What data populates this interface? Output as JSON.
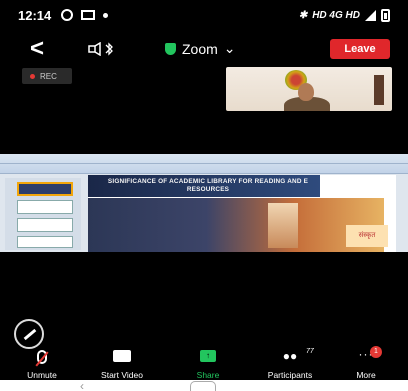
{
  "status_bar": {
    "time": "12:14",
    "network": "HD 4G HD",
    "battery_icon": "battery-icon"
  },
  "header": {
    "back_icon": "back-chevron-icon",
    "speaker_icon": "bluetooth-speaker-icon",
    "title": "Zoom",
    "title_chevron": "⌄",
    "leave_label": "Leave"
  },
  "rec_label": "REC",
  "video": {
    "participant_icon": "participant-video-icon"
  },
  "shared_slide": {
    "title": "SIGNIFICANCE OF ACADEMIC LIBRARY FOR READING AND E RESOURCES",
    "sanskrit_text": "संस्कृत"
  },
  "toolbar": {
    "items": [
      {
        "label": "Unmute",
        "icon": "muted-mic-icon"
      },
      {
        "label": "Start Video",
        "icon": "video-off-icon"
      },
      {
        "label": "Share",
        "icon": "share-screen-icon"
      },
      {
        "label": "Participants",
        "icon": "participants-icon",
        "count": "77"
      },
      {
        "label": "More",
        "icon": "more-dots-icon",
        "badge": "1"
      }
    ]
  },
  "colors": {
    "leave": "#e0272b",
    "share": "#22c55e",
    "rec_dot": "#e53935"
  }
}
